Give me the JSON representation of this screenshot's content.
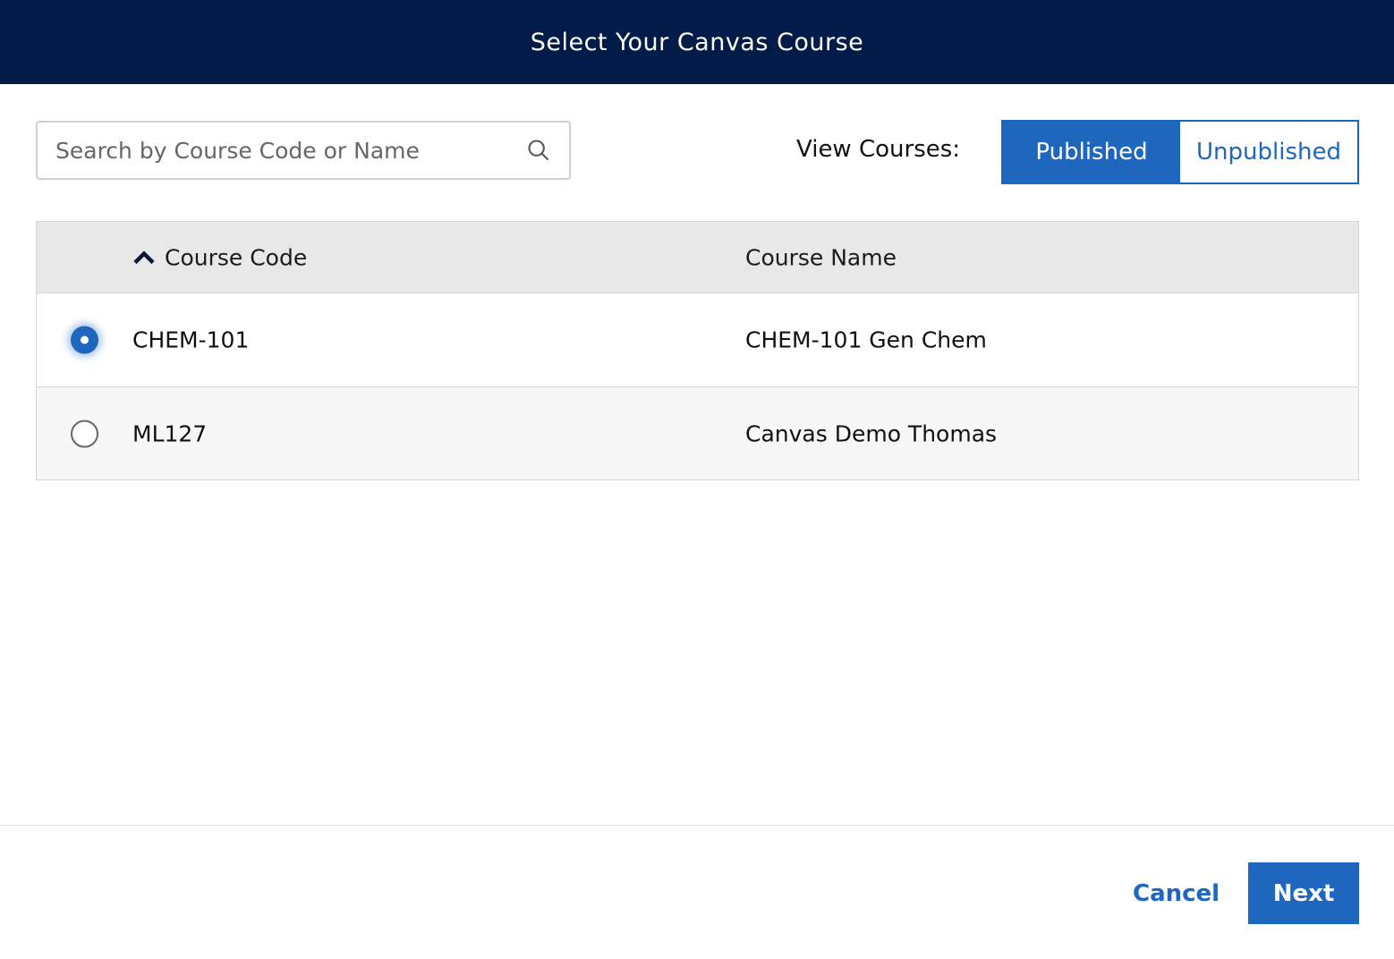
{
  "header": {
    "title": "Select Your Canvas Course"
  },
  "search": {
    "placeholder": "Search by Course Code or Name",
    "value": "",
    "icon": "search-icon"
  },
  "view_courses": {
    "label": "View Courses:",
    "options": [
      "Published",
      "Unpublished"
    ],
    "selected": "Published"
  },
  "table": {
    "columns": [
      "Course Code",
      "Course Name"
    ],
    "sort": {
      "column": "Course Code",
      "direction": "ascending"
    },
    "rows": [
      {
        "code": "CHEM-101",
        "name": "CHEM-101 Gen Chem",
        "selected": true
      },
      {
        "code": "ML127",
        "name": "Canvas Demo Thomas",
        "selected": false
      }
    ]
  },
  "footer": {
    "cancel_label": "Cancel",
    "next_label": "Next"
  },
  "colors": {
    "header_bg": "#011c48",
    "accent": "#1e66be"
  }
}
